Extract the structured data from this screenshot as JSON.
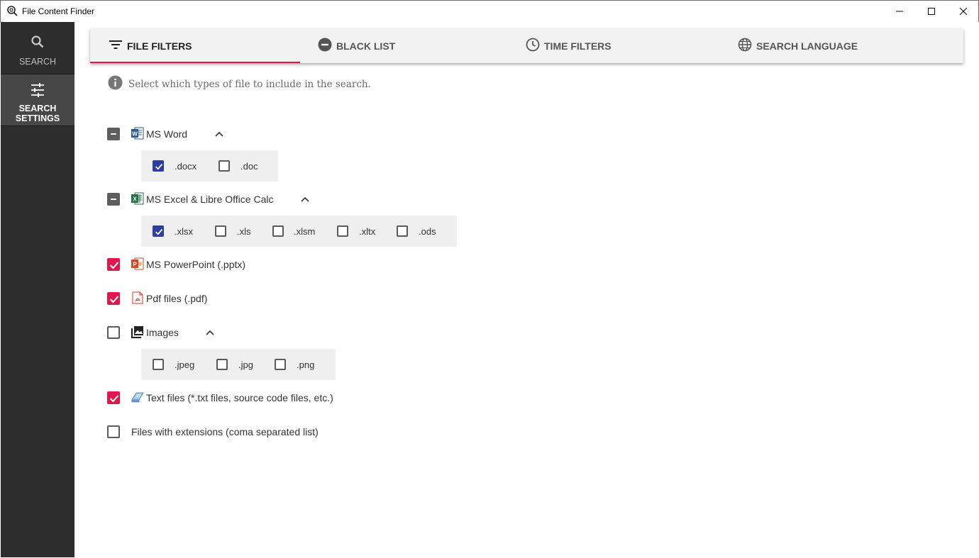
{
  "window": {
    "title": "File Content Finder"
  },
  "sidebar": {
    "items": [
      {
        "label": "SEARCH",
        "icon": "search-icon"
      },
      {
        "label": "SEARCH SETTINGS",
        "icon": "sliders-icon"
      }
    ]
  },
  "tabs": [
    {
      "label": "FILE FILTERS",
      "icon": "filter-icon"
    },
    {
      "label": "BLACK LIST",
      "icon": "minus-circle-icon"
    },
    {
      "label": "TIME FILTERS",
      "icon": "clock-icon"
    },
    {
      "label": "SEARCH LANGUAGE",
      "icon": "globe-icon"
    }
  ],
  "info": {
    "text": "Select which types of file to include in the search."
  },
  "file_types": {
    "word": {
      "label": "MS Word",
      "state": "indeterminate",
      "extensions": [
        {
          "label": ".docx",
          "checked": true
        },
        {
          "label": ".doc",
          "checked": false
        }
      ]
    },
    "excel": {
      "label": "MS Excel & Libre Office Calc",
      "state": "indeterminate",
      "extensions": [
        {
          "label": ".xlsx",
          "checked": true
        },
        {
          "label": ".xls",
          "checked": false
        },
        {
          "label": ".xlsm",
          "checked": false
        },
        {
          "label": ".xltx",
          "checked": false
        },
        {
          "label": ".ods",
          "checked": false
        }
      ]
    },
    "powerpoint": {
      "label": "MS PowerPoint (.pptx)",
      "state": "checked"
    },
    "pdf": {
      "label": "Pdf files (.pdf)",
      "state": "checked"
    },
    "images": {
      "label": "Images",
      "state": "unchecked",
      "extensions": [
        {
          "label": ".jpeg",
          "checked": false
        },
        {
          "label": ".jpg",
          "checked": false
        },
        {
          "label": ".png",
          "checked": false
        }
      ]
    },
    "text": {
      "label": "Text files (*.txt files, source code files, etc.)",
      "state": "checked"
    },
    "custom": {
      "label": "Files with extensions (coma separated list)",
      "state": "unchecked"
    }
  },
  "colors": {
    "accent": "#e0174d",
    "checkbox_blue": "#2c3e9f",
    "sidebar": "#2d2d2d"
  }
}
